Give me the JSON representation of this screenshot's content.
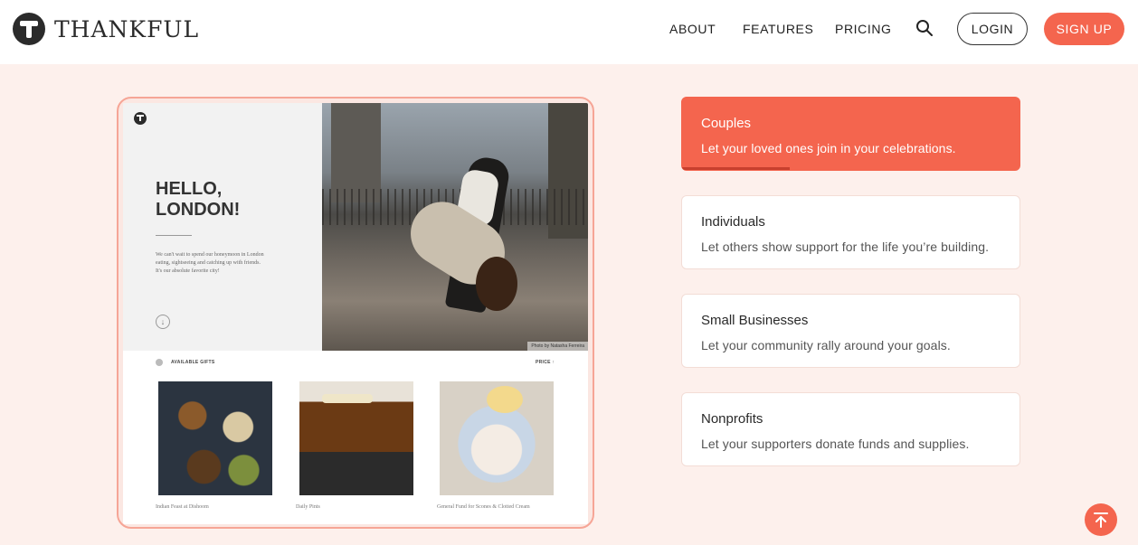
{
  "brand": {
    "name": "THANKFUL"
  },
  "nav": {
    "about": "ABOUT",
    "features": "FEATURES",
    "pricing": "PRICING",
    "login": "LOGIN",
    "signup": "SIGN UP"
  },
  "preview": {
    "hero_title": "HELLO,\nLONDON!",
    "hero_text": "We can't wait to spend our honeymoon in London eating, sightseeing and catching up with friends. It's our absolute favorite city!",
    "photo_credit": "Photo by Natasha Ferreira",
    "filter_label": "AVAILABLE GIFTS",
    "sort_label": "PRICE ↑",
    "gifts": [
      {
        "name": "Indian Feast at Dishoom"
      },
      {
        "name": "Daily Pints"
      },
      {
        "name": "General Fund for Scones & Clotted Cream"
      }
    ]
  },
  "use_cases": [
    {
      "title": "Couples",
      "desc": "Let your loved ones join in your celebrations.",
      "active": true,
      "progress": 0.32
    },
    {
      "title": "Individuals",
      "desc": "Let others show support for the life you’re building.",
      "active": false
    },
    {
      "title": "Small Businesses",
      "desc": "Let your community rally around your goals.",
      "active": false
    },
    {
      "title": "Nonprofits",
      "desc": "Let your supporters donate funds and supplies.",
      "active": false
    }
  ],
  "colors": {
    "accent": "#f4654e",
    "background": "#fdf0ec",
    "dark": "#2b2b2b"
  },
  "icons": {
    "search": "search-icon",
    "scroll_top": "arrow-up-to-top-icon"
  }
}
